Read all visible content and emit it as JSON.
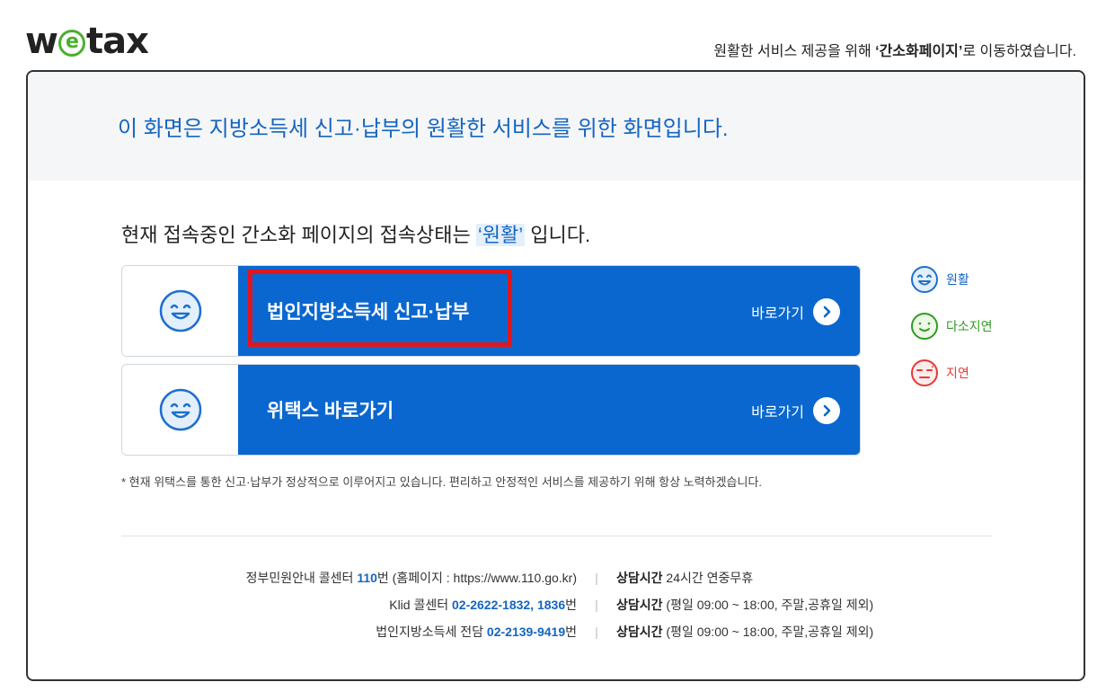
{
  "header": {
    "logo_prefix": "w",
    "logo_e": "e",
    "logo_suffix": "tax",
    "redirect_prefix": "원활한 서비스 제공을 위해 ",
    "redirect_bold": "‘간소화페이지’",
    "redirect_suffix": "로 이동하였습니다."
  },
  "panel": {
    "heading": "이 화면은 지방소득세 신고·납부의 원활한 서비스를 위한 화면입니다.",
    "status_prefix": "현재 접속중인 간소화 페이지의 접속상태는 ",
    "status_value": "‘원활’",
    "status_suffix": " 입니다."
  },
  "cards": [
    {
      "title": "법인지방소득세 신고·납부",
      "go_label": "바로가기",
      "face": "smile-face-icon"
    },
    {
      "title": "위택스 바로가기",
      "go_label": "바로가기",
      "face": "smile-face-icon"
    }
  ],
  "legend": [
    {
      "label": "원활",
      "color": "#1565c0",
      "icon": "smile-face-icon"
    },
    {
      "label": "다소지연",
      "color": "#2e9d1f",
      "icon": "neutral-face-icon"
    },
    {
      "label": "지연",
      "color": "#e53935",
      "icon": "sad-face-icon"
    }
  ],
  "notice": "* 현재 위택스를 통한 신고·납부가 정상적으로 이루어지고 있습니다. 편리하고 안정적인 서비스를 제공하기 위해 항상 노력하겠습니다.",
  "contacts": [
    {
      "pre": "정부민원안내 콜센터 ",
      "num": "110",
      "post": "번 (홈페이지 : https://www.110.go.kr)",
      "hours_label": "상담시간",
      "hours": " 24시간 연중무휴"
    },
    {
      "pre": "Klid 콜센터 ",
      "num": "02-2622-1832, 1836",
      "post": "번",
      "hours_label": "상담시간",
      "hours": " (평일 09:00 ~ 18:00, 주말,공휴일 제외)"
    },
    {
      "pre": "법인지방소득세 전담 ",
      "num": "02-2139-9419",
      "post": "번",
      "hours_label": "상담시간",
      "hours": " (평일 09:00 ~ 18:00, 주말,공휴일 제외)"
    }
  ],
  "separator": "|",
  "colors": {
    "accent_blue": "#0a67cf",
    "highlight_red": "#e0161e",
    "green": "#4caf2e"
  }
}
